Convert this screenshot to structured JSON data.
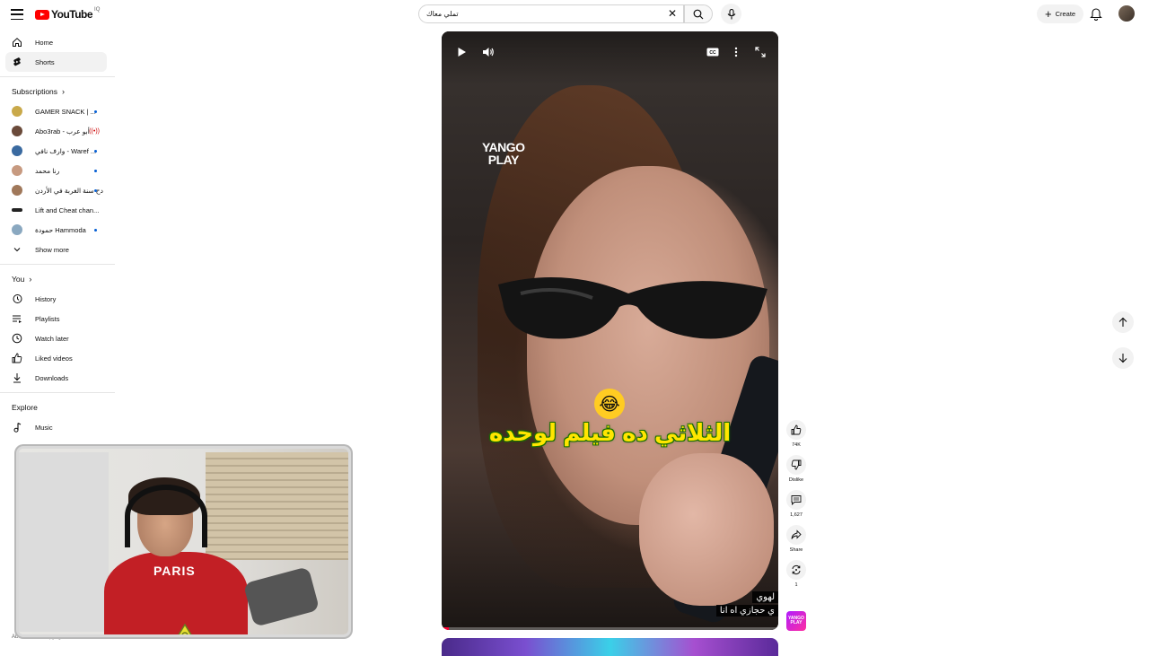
{
  "header": {
    "logo_text": "YouTube",
    "logo_country": "IQ",
    "search_value": "تملي معاك",
    "create_label": "Create"
  },
  "sidebar": {
    "main": [
      {
        "label": "Home",
        "icon": "home-icon"
      },
      {
        "label": "Shorts",
        "icon": "shorts-icon"
      }
    ],
    "subscriptions_heading": "Subscriptions",
    "subscriptions": [
      {
        "label": "GAMER SNACK | ...",
        "indicator": "dot",
        "avatar_color": "#c9a94a"
      },
      {
        "label": "Abo3rab - أبو عرب",
        "indicator": "live",
        "avatar_color": "#6a4a3a"
      },
      {
        "label": "وارف نافي - Waref ...",
        "indicator": "dot",
        "avatar_color": "#3a6aa0"
      },
      {
        "label": "رنا محمد",
        "indicator": "dot",
        "avatar_color": "#c79a80"
      },
      {
        "label": "دح سنة الغربة في الأردن",
        "indicator": "dot",
        "avatar_color": "#a0785a"
      },
      {
        "label": "Lift and Cheat chan...",
        "indicator": "",
        "avatar_color": "#222222"
      },
      {
        "label": "حمودة Hammoda",
        "indicator": "dot",
        "avatar_color": "#8aa8c0"
      }
    ],
    "show_more": "Show more",
    "you_heading": "You",
    "you_items": [
      {
        "label": "History",
        "icon": "history-icon"
      },
      {
        "label": "Playlists",
        "icon": "playlists-icon"
      },
      {
        "label": "Watch later",
        "icon": "watch-later-icon"
      },
      {
        "label": "Liked videos",
        "icon": "liked-icon"
      },
      {
        "label": "Downloads",
        "icon": "download-icon"
      }
    ],
    "explore_heading": "Explore",
    "explore_items": [
      {
        "label": "Music",
        "icon": "music-icon"
      }
    ],
    "footer": "About  Press  Copyright"
  },
  "player": {
    "brand_logo_line1": "YANGO",
    "brand_logo_line2": "PLAY",
    "emoji": "😂",
    "caption": "الثلاثي ده فيلم لوحده",
    "subtitle_line1": "لهوي",
    "subtitle_line2": "ي حجازي اه انا",
    "progress_fraction": 0.02,
    "cc_label": "CC"
  },
  "actions": {
    "like_count": "74K",
    "dislike_label": "Dislike",
    "comment_count": "1,627",
    "share_label": "Share",
    "remix_count": "1",
    "channel_thumb_text": "YANGO PLAY"
  },
  "webcam": {
    "shirt_text": "PARIS"
  }
}
